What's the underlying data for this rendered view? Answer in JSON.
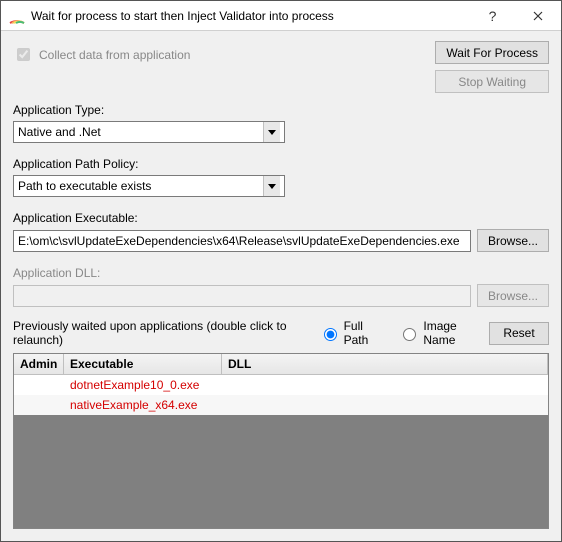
{
  "title": "Wait for process to start then Inject Validator into process",
  "collect_label": "Collect data from application",
  "wait_btn": "Wait For Process",
  "stop_btn": "Stop Waiting",
  "app_type_label": "Application Type:",
  "app_type_value": "Native and .Net",
  "path_policy_label": "Application Path Policy:",
  "path_policy_value": "Path to executable exists",
  "exec_label": "Application Executable:",
  "exec_value": "E:\\om\\c\\svlUpdateExeDependencies\\x64\\Release\\svlUpdateExeDependencies.exe",
  "browse": "Browse...",
  "dll_label": "Application DLL:",
  "dll_value": "",
  "prev_label": "Previously waited upon applications (double click to relaunch)",
  "radio_full": "Full Path",
  "radio_image": "Image Name",
  "reset": "Reset",
  "columns": {
    "admin": "Admin",
    "exec": "Executable",
    "dll": "DLL"
  },
  "rows": [
    {
      "admin": "",
      "exec": "dotnetExample10_0.exe",
      "dll": ""
    },
    {
      "admin": "",
      "exec": "nativeExample_x64.exe",
      "dll": ""
    }
  ]
}
